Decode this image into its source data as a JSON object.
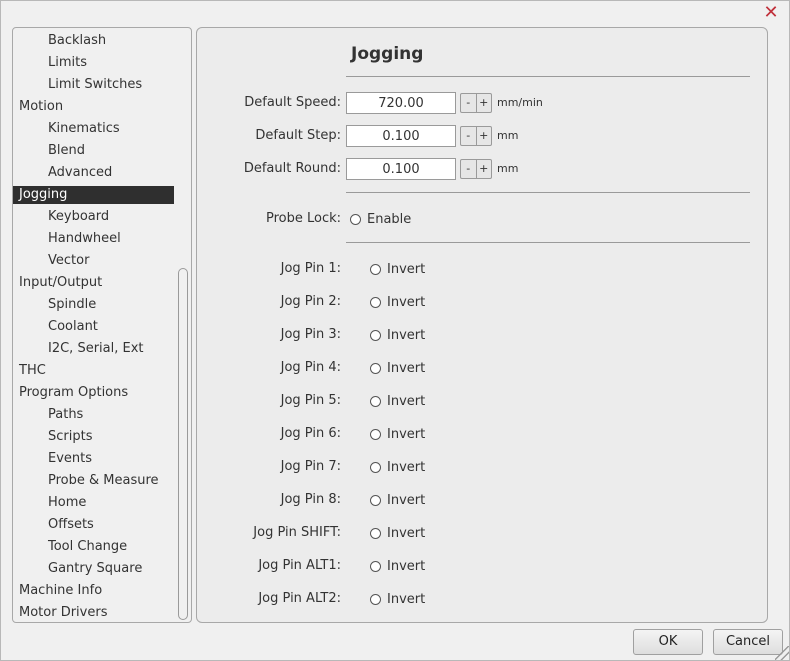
{
  "dialog": {
    "close_glyph": "✕",
    "ok_label": "OK",
    "cancel_label": "Cancel"
  },
  "sidebar": {
    "items": [
      {
        "label": "Backlash",
        "level": 1
      },
      {
        "label": "Limits",
        "level": 1
      },
      {
        "label": "Limit Switches",
        "level": 1
      },
      {
        "label": "Motion",
        "level": 0
      },
      {
        "label": "Kinematics",
        "level": 1
      },
      {
        "label": "Blend",
        "level": 1
      },
      {
        "label": "Advanced",
        "level": 1
      },
      {
        "label": "Jogging",
        "level": 0,
        "selected": true
      },
      {
        "label": "Keyboard",
        "level": 1
      },
      {
        "label": "Handwheel",
        "level": 1
      },
      {
        "label": "Vector",
        "level": 1
      },
      {
        "label": "Input/Output",
        "level": 0
      },
      {
        "label": "Spindle",
        "level": 1
      },
      {
        "label": "Coolant",
        "level": 1
      },
      {
        "label": "I2C, Serial, Ext",
        "level": 1
      },
      {
        "label": "THC",
        "level": 0
      },
      {
        "label": "Program Options",
        "level": 0
      },
      {
        "label": "Paths",
        "level": 1
      },
      {
        "label": "Scripts",
        "level": 1
      },
      {
        "label": "Events",
        "level": 1
      },
      {
        "label": "Probe & Measure",
        "level": 1
      },
      {
        "label": "Home",
        "level": 1
      },
      {
        "label": "Offsets",
        "level": 1
      },
      {
        "label": "Tool Change",
        "level": 1
      },
      {
        "label": "Gantry Square",
        "level": 1
      },
      {
        "label": "Machine Info",
        "level": 0
      },
      {
        "label": "Motor Drivers",
        "level": 0
      }
    ]
  },
  "panel": {
    "title": "Jogging",
    "stepper_minus": "-",
    "stepper_plus": "+",
    "fields": [
      {
        "label": "Default Speed:",
        "value": "720.00",
        "unit": "mm/min"
      },
      {
        "label": "Default Step:",
        "value": "0.100",
        "unit": "mm"
      },
      {
        "label": "Default Round:",
        "value": "0.100",
        "unit": "mm"
      }
    ],
    "probe_lock": {
      "label": "Probe Lock:",
      "option": "Enable"
    },
    "jog_pins": [
      {
        "label": "Jog Pin 1:",
        "option": "Invert"
      },
      {
        "label": "Jog Pin 2:",
        "option": "Invert"
      },
      {
        "label": "Jog Pin 3:",
        "option": "Invert"
      },
      {
        "label": "Jog Pin 4:",
        "option": "Invert"
      },
      {
        "label": "Jog Pin 5:",
        "option": "Invert"
      },
      {
        "label": "Jog Pin 6:",
        "option": "Invert"
      },
      {
        "label": "Jog Pin 7:",
        "option": "Invert"
      },
      {
        "label": "Jog Pin 8:",
        "option": "Invert"
      },
      {
        "label": "Jog Pin SHIFT:",
        "option": "Invert"
      },
      {
        "label": "Jog Pin ALT1:",
        "option": "Invert"
      },
      {
        "label": "Jog Pin ALT2:",
        "option": "Invert"
      }
    ]
  },
  "colors": {
    "selected_bg": "#2f2f2f",
    "close_icon": "#c0303a"
  }
}
